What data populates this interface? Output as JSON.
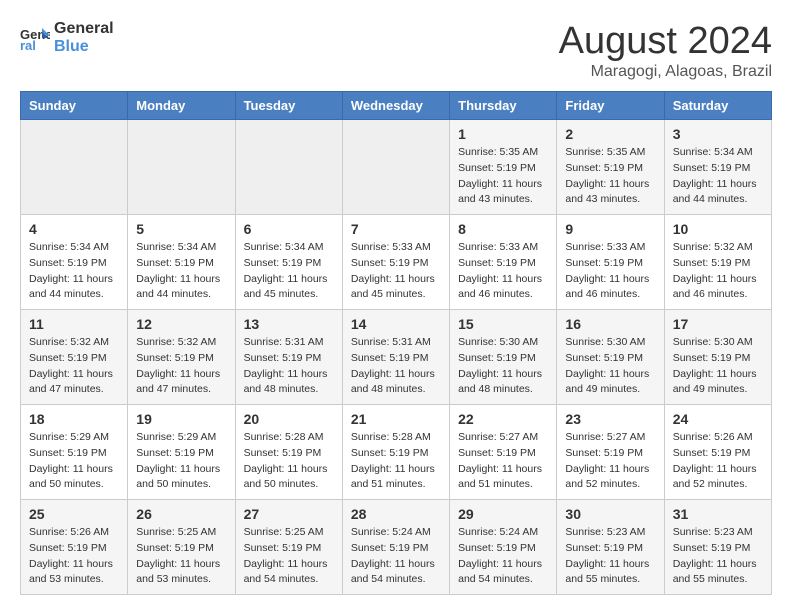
{
  "header": {
    "logo_line1": "General",
    "logo_line2": "Blue",
    "month": "August 2024",
    "location": "Maragogi, Alagoas, Brazil"
  },
  "weekdays": [
    "Sunday",
    "Monday",
    "Tuesday",
    "Wednesday",
    "Thursday",
    "Friday",
    "Saturday"
  ],
  "weeks": [
    [
      {
        "day": "",
        "info": ""
      },
      {
        "day": "",
        "info": ""
      },
      {
        "day": "",
        "info": ""
      },
      {
        "day": "",
        "info": ""
      },
      {
        "day": "1",
        "info": "Sunrise: 5:35 AM\nSunset: 5:19 PM\nDaylight: 11 hours\nand 43 minutes."
      },
      {
        "day": "2",
        "info": "Sunrise: 5:35 AM\nSunset: 5:19 PM\nDaylight: 11 hours\nand 43 minutes."
      },
      {
        "day": "3",
        "info": "Sunrise: 5:34 AM\nSunset: 5:19 PM\nDaylight: 11 hours\nand 44 minutes."
      }
    ],
    [
      {
        "day": "4",
        "info": "Sunrise: 5:34 AM\nSunset: 5:19 PM\nDaylight: 11 hours\nand 44 minutes."
      },
      {
        "day": "5",
        "info": "Sunrise: 5:34 AM\nSunset: 5:19 PM\nDaylight: 11 hours\nand 44 minutes."
      },
      {
        "day": "6",
        "info": "Sunrise: 5:34 AM\nSunset: 5:19 PM\nDaylight: 11 hours\nand 45 minutes."
      },
      {
        "day": "7",
        "info": "Sunrise: 5:33 AM\nSunset: 5:19 PM\nDaylight: 11 hours\nand 45 minutes."
      },
      {
        "day": "8",
        "info": "Sunrise: 5:33 AM\nSunset: 5:19 PM\nDaylight: 11 hours\nand 46 minutes."
      },
      {
        "day": "9",
        "info": "Sunrise: 5:33 AM\nSunset: 5:19 PM\nDaylight: 11 hours\nand 46 minutes."
      },
      {
        "day": "10",
        "info": "Sunrise: 5:32 AM\nSunset: 5:19 PM\nDaylight: 11 hours\nand 46 minutes."
      }
    ],
    [
      {
        "day": "11",
        "info": "Sunrise: 5:32 AM\nSunset: 5:19 PM\nDaylight: 11 hours\nand 47 minutes."
      },
      {
        "day": "12",
        "info": "Sunrise: 5:32 AM\nSunset: 5:19 PM\nDaylight: 11 hours\nand 47 minutes."
      },
      {
        "day": "13",
        "info": "Sunrise: 5:31 AM\nSunset: 5:19 PM\nDaylight: 11 hours\nand 48 minutes."
      },
      {
        "day": "14",
        "info": "Sunrise: 5:31 AM\nSunset: 5:19 PM\nDaylight: 11 hours\nand 48 minutes."
      },
      {
        "day": "15",
        "info": "Sunrise: 5:30 AM\nSunset: 5:19 PM\nDaylight: 11 hours\nand 48 minutes."
      },
      {
        "day": "16",
        "info": "Sunrise: 5:30 AM\nSunset: 5:19 PM\nDaylight: 11 hours\nand 49 minutes."
      },
      {
        "day": "17",
        "info": "Sunrise: 5:30 AM\nSunset: 5:19 PM\nDaylight: 11 hours\nand 49 minutes."
      }
    ],
    [
      {
        "day": "18",
        "info": "Sunrise: 5:29 AM\nSunset: 5:19 PM\nDaylight: 11 hours\nand 50 minutes."
      },
      {
        "day": "19",
        "info": "Sunrise: 5:29 AM\nSunset: 5:19 PM\nDaylight: 11 hours\nand 50 minutes."
      },
      {
        "day": "20",
        "info": "Sunrise: 5:28 AM\nSunset: 5:19 PM\nDaylight: 11 hours\nand 50 minutes."
      },
      {
        "day": "21",
        "info": "Sunrise: 5:28 AM\nSunset: 5:19 PM\nDaylight: 11 hours\nand 51 minutes."
      },
      {
        "day": "22",
        "info": "Sunrise: 5:27 AM\nSunset: 5:19 PM\nDaylight: 11 hours\nand 51 minutes."
      },
      {
        "day": "23",
        "info": "Sunrise: 5:27 AM\nSunset: 5:19 PM\nDaylight: 11 hours\nand 52 minutes."
      },
      {
        "day": "24",
        "info": "Sunrise: 5:26 AM\nSunset: 5:19 PM\nDaylight: 11 hours\nand 52 minutes."
      }
    ],
    [
      {
        "day": "25",
        "info": "Sunrise: 5:26 AM\nSunset: 5:19 PM\nDaylight: 11 hours\nand 53 minutes."
      },
      {
        "day": "26",
        "info": "Sunrise: 5:25 AM\nSunset: 5:19 PM\nDaylight: 11 hours\nand 53 minutes."
      },
      {
        "day": "27",
        "info": "Sunrise: 5:25 AM\nSunset: 5:19 PM\nDaylight: 11 hours\nand 54 minutes."
      },
      {
        "day": "28",
        "info": "Sunrise: 5:24 AM\nSunset: 5:19 PM\nDaylight: 11 hours\nand 54 minutes."
      },
      {
        "day": "29",
        "info": "Sunrise: 5:24 AM\nSunset: 5:19 PM\nDaylight: 11 hours\nand 54 minutes."
      },
      {
        "day": "30",
        "info": "Sunrise: 5:23 AM\nSunset: 5:19 PM\nDaylight: 11 hours\nand 55 minutes."
      },
      {
        "day": "31",
        "info": "Sunrise: 5:23 AM\nSunset: 5:19 PM\nDaylight: 11 hours\nand 55 minutes."
      }
    ]
  ]
}
